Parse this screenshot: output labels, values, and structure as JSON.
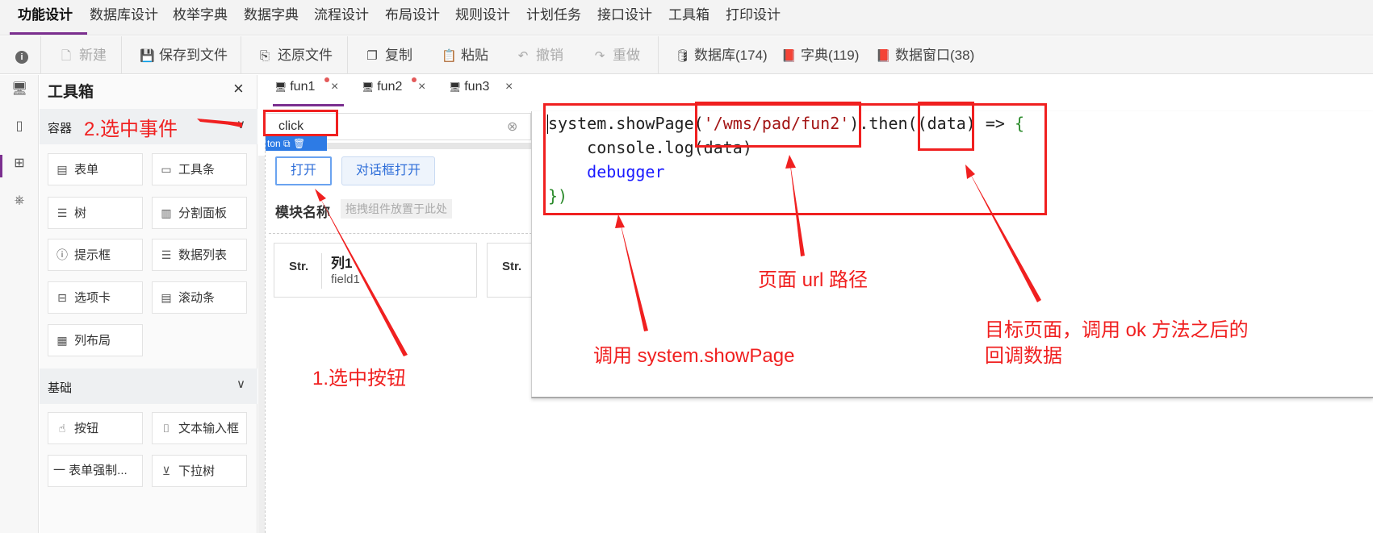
{
  "top_menu": {
    "items": [
      "功能设计",
      "数据库设计",
      "枚举字典",
      "数据字典",
      "流程设计",
      "布局设计",
      "规则设计",
      "计划任务",
      "接口设计",
      "工具箱",
      "打印设计"
    ],
    "active": "功能设计"
  },
  "toolbar": {
    "info_icon": "info-icon",
    "new": "新建",
    "save_file": "保存到文件",
    "restore_file": "还原文件",
    "copy": "复制",
    "paste": "粘贴",
    "undo": "撤销",
    "redo": "重做",
    "database": "数据库(174)",
    "dictionary": "字典(119)",
    "data_window": "数据窗口(38)"
  },
  "toolbox": {
    "title": "工具箱",
    "sections": [
      {
        "title": "容器",
        "items": [
          "表单",
          "工具条",
          "树",
          "分割面板",
          "提示框",
          "数据列表",
          "选项卡",
          "滚动条",
          "列布局"
        ]
      },
      {
        "title": "基础",
        "items": [
          "按钮",
          "文本输入框",
          "一 表单强制...",
          "下拉树"
        ]
      }
    ]
  },
  "tabs": [
    {
      "label": "fun1",
      "modified": true,
      "active": true
    },
    {
      "label": "fun2",
      "modified": true,
      "active": false
    },
    {
      "label": "fun3",
      "modified": false,
      "active": false
    }
  ],
  "event_input": {
    "value": "click"
  },
  "canvas": {
    "selected_label": "ton",
    "btn_open": "打开",
    "btn_dialog": "对话框打开",
    "module_title": "模块名称",
    "module_hint": "拖拽组件放置于此处",
    "columns": [
      {
        "type": "Str.",
        "name": "列1",
        "field": "field1"
      },
      {
        "type": "Str.",
        "name": "",
        "field": ""
      }
    ]
  },
  "code": {
    "line1_a": "system.showPage(",
    "line1_str": "'/wms/pad/fun2'",
    "line1_b": ").then(",
    "line1_c": "(data) => ",
    "line1_brace": "{",
    "line2": "    console.log(data)",
    "line3": "    debugger",
    "line4": "})"
  },
  "annotations": {
    "select_event": "2.选中事件",
    "select_button": "1.选中按钮",
    "call_showpage": "调用 system.showPage",
    "page_url": "页面 url 路径",
    "callback_line1": "目标页面，调用 ok 方法之后的",
    "callback_line2": "回调数据"
  },
  "colors": {
    "accent": "#7b2f8f",
    "annotation_red": "#f02020",
    "link_blue": "#2f6ed8"
  }
}
